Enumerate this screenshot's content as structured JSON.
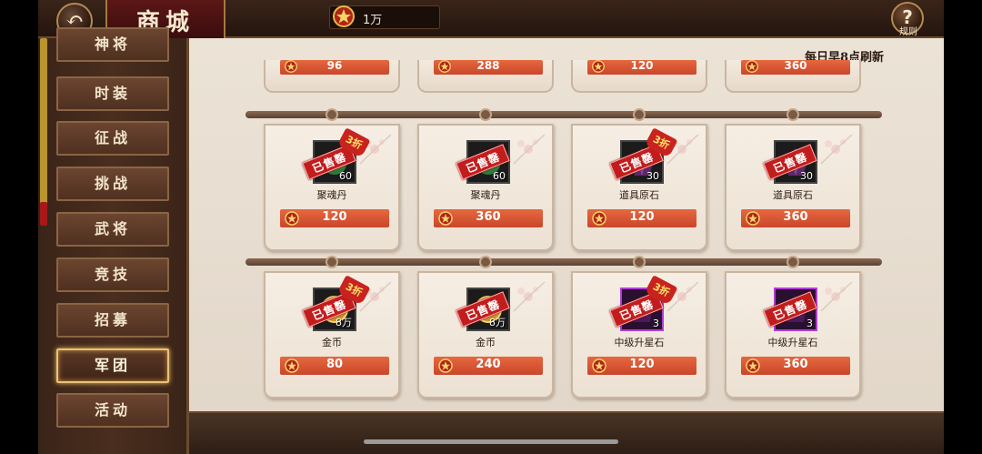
{
  "header": {
    "back_icon": "back-arrow-icon",
    "title": "商城",
    "currency": {
      "icon": "star-medal-icon",
      "value": "1万"
    },
    "rules": {
      "icon": "question-icon",
      "label": "规则"
    }
  },
  "sidebar": {
    "items": [
      {
        "label": "神将"
      },
      {
        "label": "时装"
      },
      {
        "label": "征战"
      },
      {
        "label": "挑战"
      },
      {
        "label": "武将"
      },
      {
        "label": "竞技"
      },
      {
        "label": "招募"
      },
      {
        "label": "军团",
        "active": true
      },
      {
        "label": "活动"
      }
    ]
  },
  "main": {
    "refresh_text": "每日早8点刷新",
    "prev_row_prices": [
      "96",
      "288",
      "120",
      "360"
    ],
    "rows": [
      [
        {
          "name": "聚魂丹",
          "qty": "60",
          "price": "120",
          "discount": "3折",
          "sold": "已售罄",
          "rarity": "normal",
          "icon": "elixir-icon"
        },
        {
          "name": "聚魂丹",
          "qty": "60",
          "price": "360",
          "discount": "",
          "sold": "已售罄",
          "rarity": "normal",
          "icon": "elixir-icon"
        },
        {
          "name": "道具原石",
          "qty": "30",
          "price": "120",
          "discount": "3折",
          "sold": "已售罄",
          "rarity": "normal",
          "icon": "gem-stone-icon"
        },
        {
          "name": "道具原石",
          "qty": "30",
          "price": "360",
          "discount": "",
          "sold": "已售罄",
          "rarity": "normal",
          "icon": "gem-stone-icon"
        }
      ],
      [
        {
          "name": "金币",
          "qty": "8万",
          "price": "80",
          "discount": "3折",
          "sold": "已售罄",
          "rarity": "normal",
          "icon": "gold-coin-icon"
        },
        {
          "name": "金币",
          "qty": "8万",
          "price": "240",
          "discount": "",
          "sold": "已售罄",
          "rarity": "normal",
          "icon": "gold-coin-icon"
        },
        {
          "name": "中级升星石",
          "qty": "3",
          "price": "120",
          "discount": "3折",
          "sold": "已售罄",
          "rarity": "epic",
          "icon": "star-stone-icon"
        },
        {
          "name": "中级升星石",
          "qty": "3",
          "price": "360",
          "discount": "",
          "sold": "已售罄",
          "rarity": "epic",
          "icon": "star-stone-icon"
        }
      ]
    ]
  },
  "colors": {
    "accent": "#c9462a",
    "sold": "#c21d1d",
    "epic": "#b23cd8",
    "gold": "#e8c27a"
  }
}
